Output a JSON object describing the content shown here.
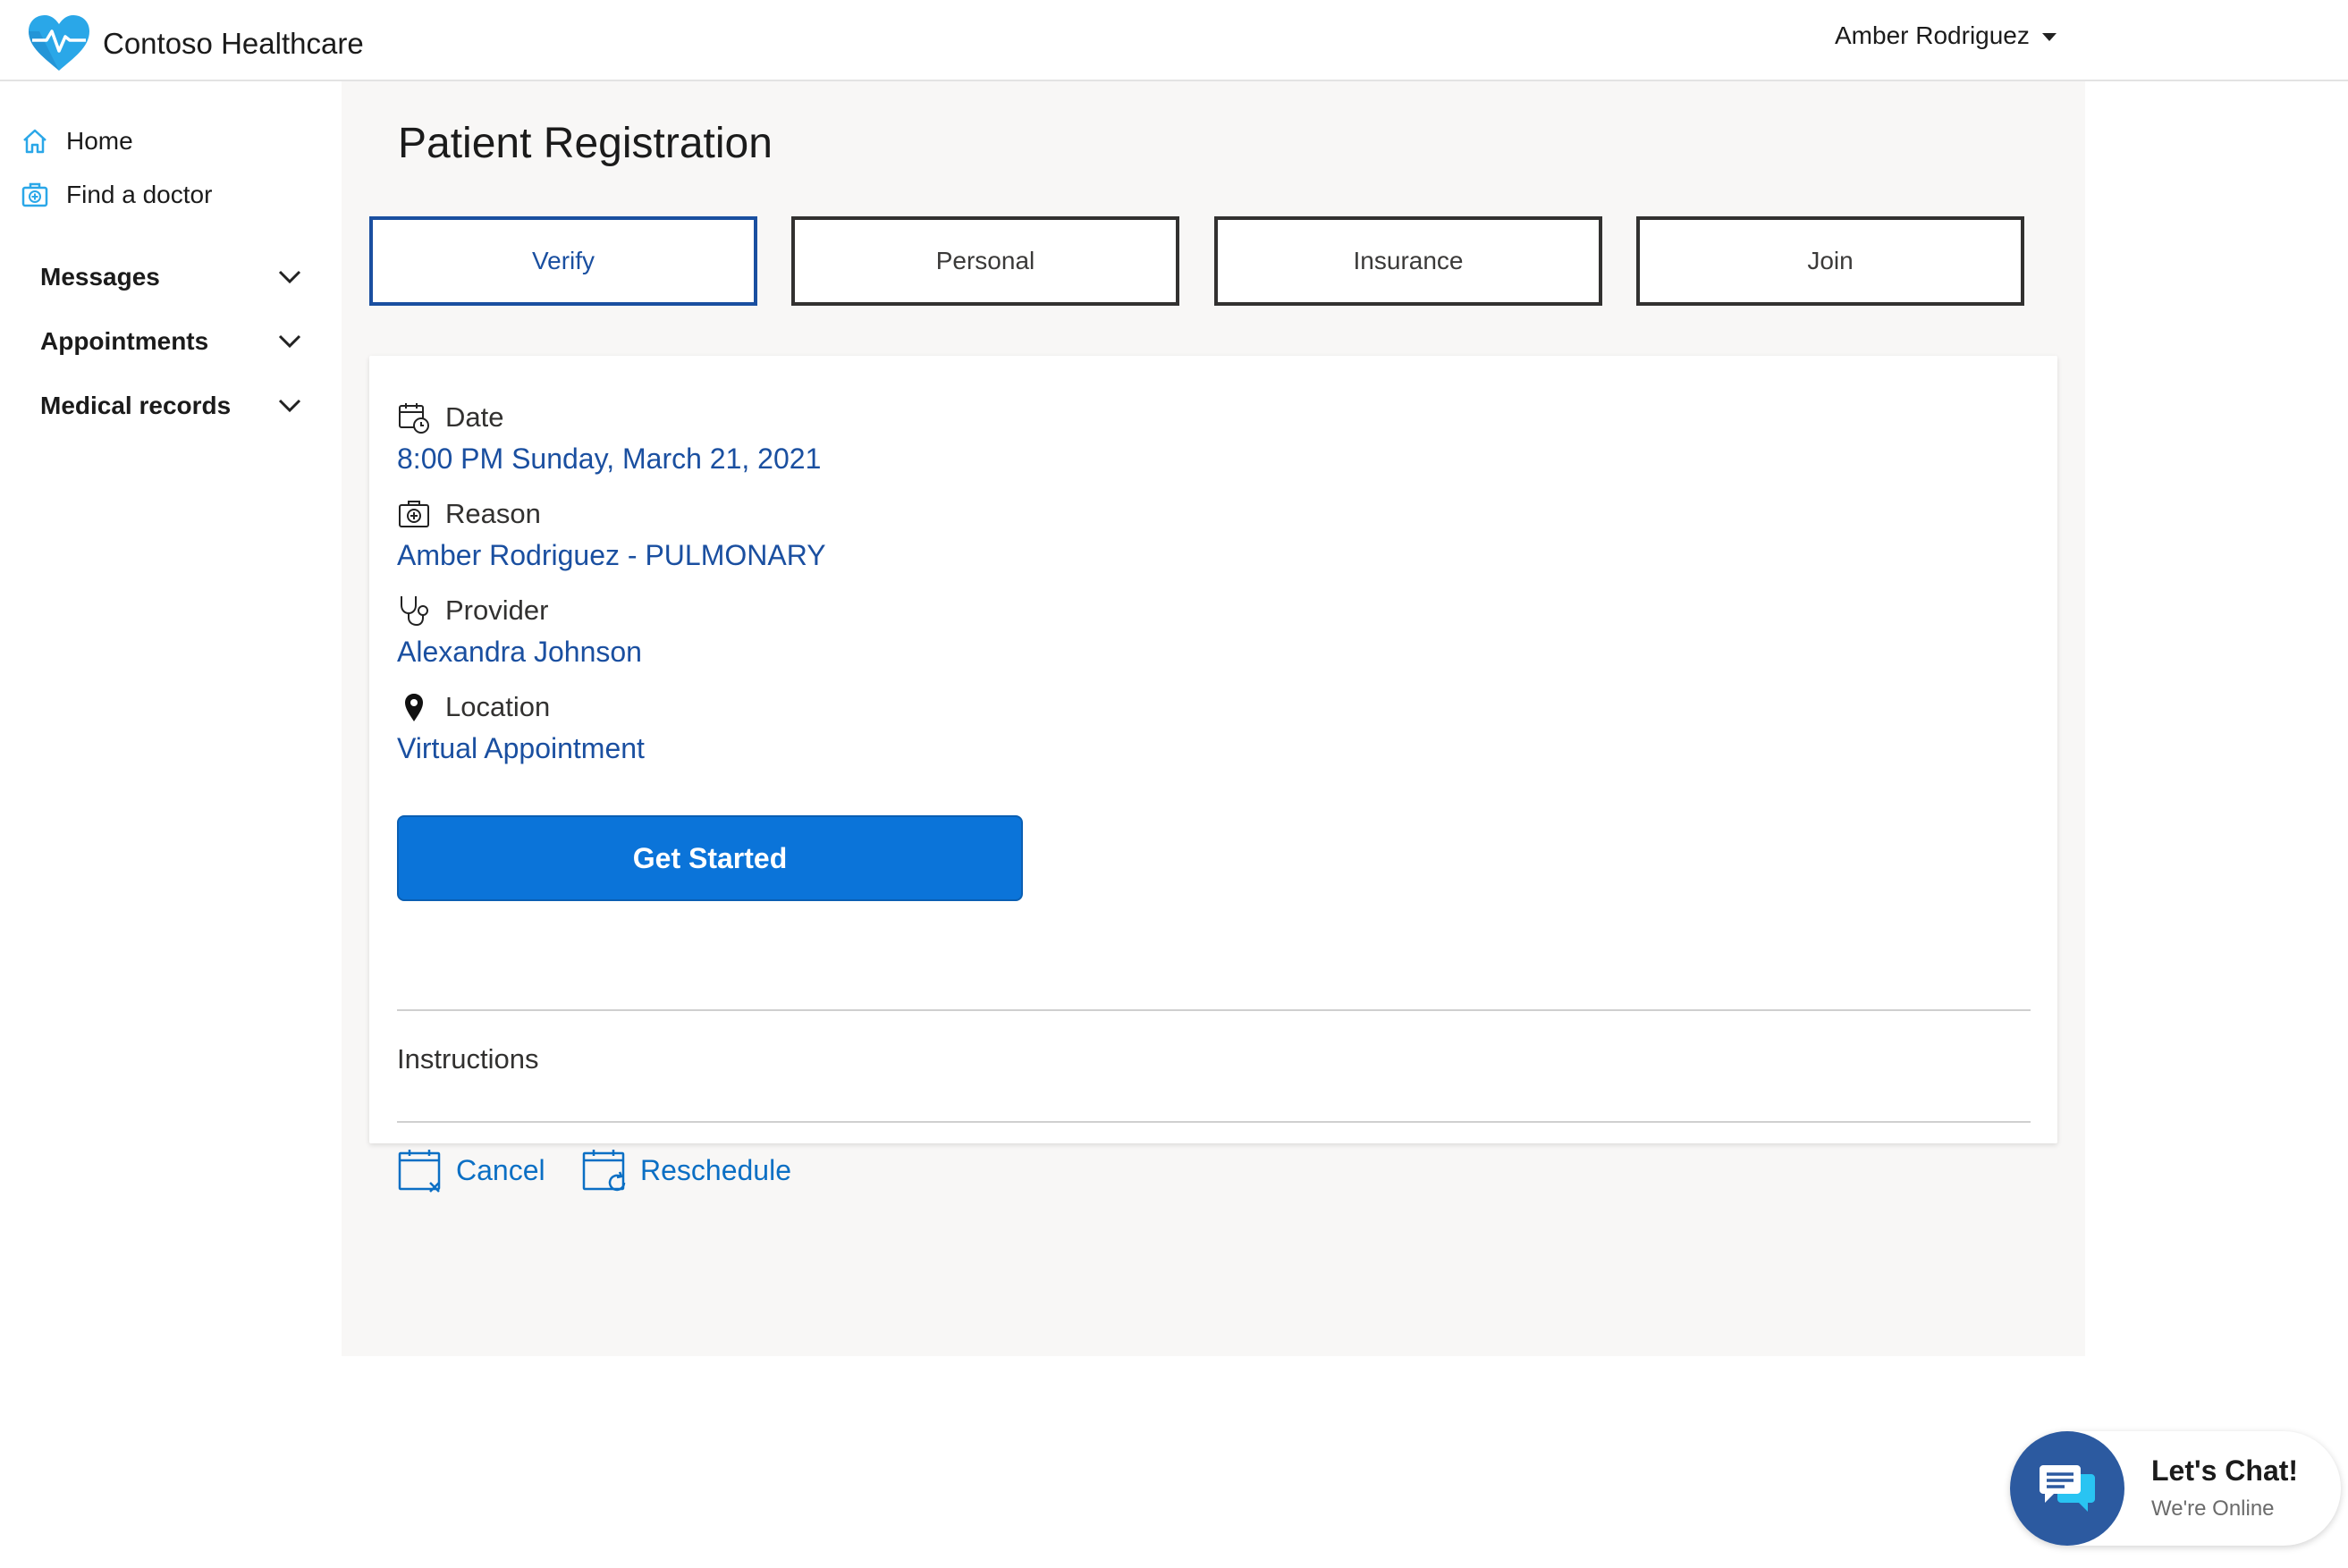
{
  "header": {
    "brand": "Contoso Healthcare",
    "user_name": "Amber Rodriguez"
  },
  "sidebar": {
    "links": [
      {
        "label": "Home",
        "icon": "home-icon"
      },
      {
        "label": "Find a doctor",
        "icon": "medical-bag-icon"
      }
    ],
    "sections": [
      {
        "label": "Messages",
        "icon": "chevron-down-icon"
      },
      {
        "label": "Appointments",
        "icon": "chevron-down-icon"
      },
      {
        "label": "Medical records",
        "icon": "chevron-down-icon"
      }
    ]
  },
  "main": {
    "title": "Patient Registration",
    "steps": [
      {
        "label": "Verify",
        "active": true
      },
      {
        "label": "Personal",
        "active": false
      },
      {
        "label": "Insurance",
        "active": false
      },
      {
        "label": "Join",
        "active": false
      }
    ],
    "appointment": {
      "date_label": "Date",
      "date_value": "8:00 PM Sunday, March 21, 2021",
      "reason_label": "Reason",
      "reason_value": "Amber Rodriguez - PULMONARY",
      "provider_label": "Provider",
      "provider_value": "Alexandra Johnson",
      "location_label": "Location",
      "location_value": "Virtual Appointment"
    },
    "get_started_label": "Get Started",
    "instructions_label": "Instructions",
    "cancel_label": "Cancel",
    "reschedule_label": "Reschedule"
  },
  "chat": {
    "title": "Let's Chat!",
    "status": "We're Online"
  },
  "colors": {
    "accent": "#1a4fa0",
    "primary_button": "#0b74d9",
    "link": "#0b6fc4",
    "logo": "#2aa7e8",
    "chat_bubble": "#2c5aa0"
  }
}
